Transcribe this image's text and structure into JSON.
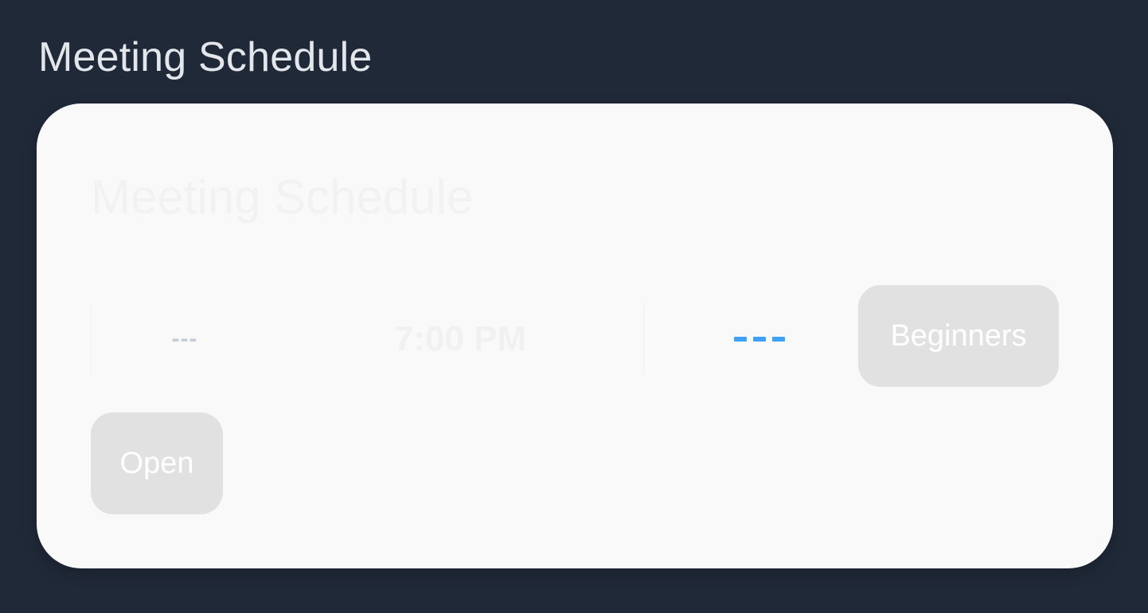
{
  "page": {
    "title": "Meeting Schedule"
  },
  "card": {
    "title": "Meeting Schedule",
    "date": "---",
    "time": "7:00 PM",
    "status_icon": "dashes-icon",
    "level_tag": "Beginners",
    "availability_tag": "Open"
  },
  "colors": {
    "background": "#202938",
    "card": "#f9f9f9",
    "accent": "#3fa1f4",
    "chip": "#e1e1e1"
  }
}
